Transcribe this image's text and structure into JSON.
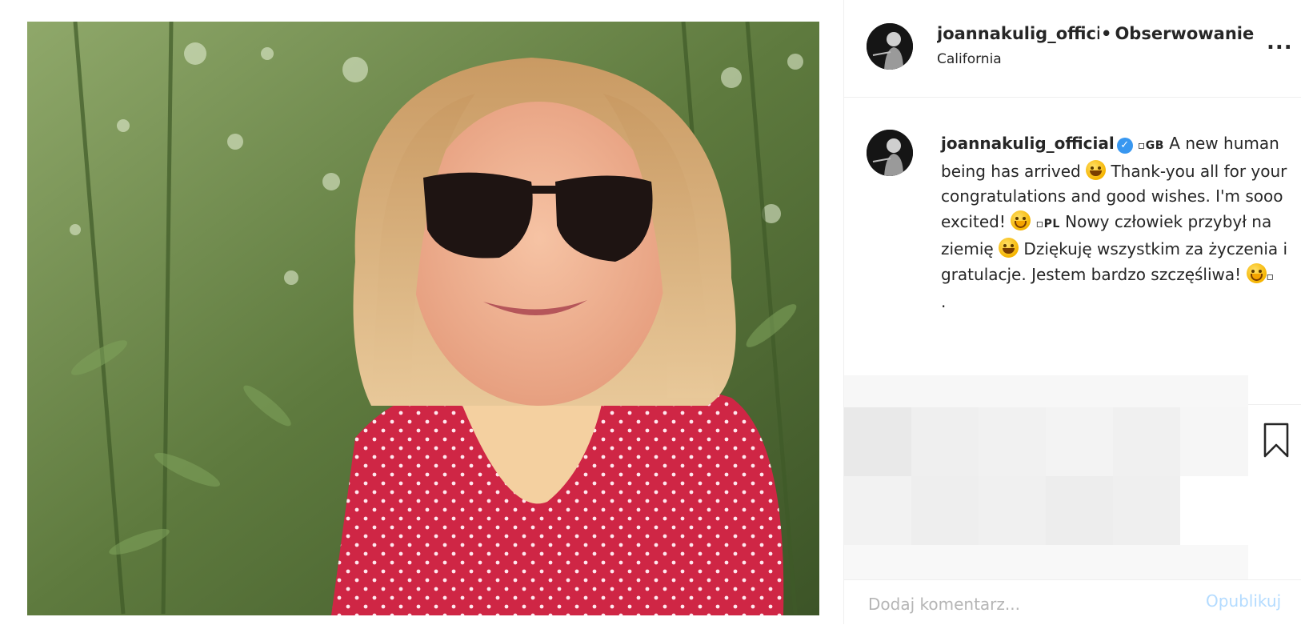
{
  "post": {
    "image_alt": "Selfie of a woman with blonde hair and sunglasses in a red polka-dot shirt, bamboo in background"
  },
  "header": {
    "username": "joannakulig_official",
    "separator": "•",
    "follow_status": "Obserwowanie",
    "location": "California",
    "more_label": "..."
  },
  "caption": {
    "username": "joannakulig_official",
    "verified_glyph": "✓",
    "flag_gb": "GB",
    "text_en_1": "A new human being has arrived",
    "text_en_2": "Thank-you all for your congratulations and good wishes. I'm sooo excited!",
    "flag_pl": "PL",
    "text_pl_1": "Nowy człowiek przybył na ziemię",
    "text_pl_2": "Dziękuję wszystkim za życzenia i gratulacje. Jestem bardzo szczęśliwa!",
    "trailing_dot": "."
  },
  "comment": {
    "placeholder": "Dodaj komentarz...",
    "post_label": "Opublikuj"
  },
  "icons": {
    "more": "more-icon",
    "bookmark": "bookmark-icon",
    "verified": "verified-badge-icon",
    "emoji_grin": "grinning-emoji-icon",
    "emoji_hug": "hugging-emoji-icon"
  },
  "colors": {
    "accent_blue": "#3897f0",
    "post_button_disabled": "#b3dbff",
    "text": "#262626",
    "divider": "#efefef"
  }
}
